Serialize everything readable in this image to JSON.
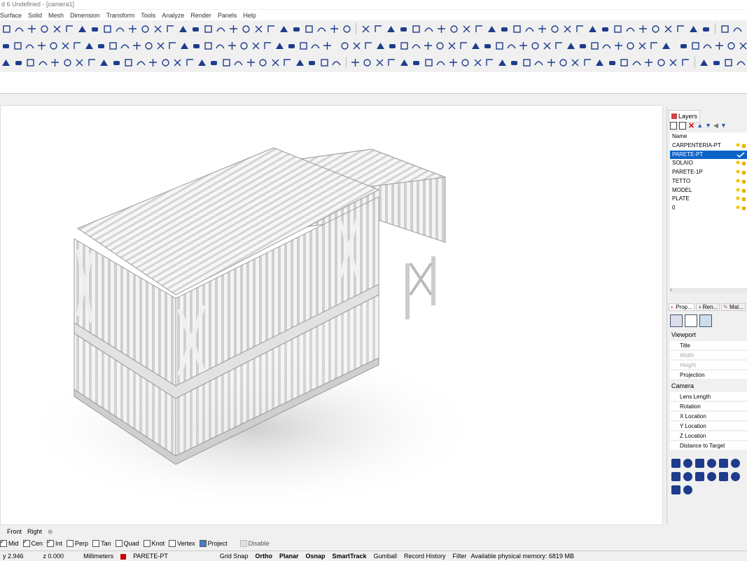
{
  "window": {
    "title": "d 6 Undefined - [camera1]"
  },
  "menu": [
    "Surface",
    "Solid",
    "Mesh",
    "Dimension",
    "Transform",
    "Tools",
    "Analyze",
    "Render",
    "Panels",
    "Help"
  ],
  "layers_panel": {
    "tab_label": "Layers",
    "column_name": "Name",
    "layers": [
      {
        "name": "CARPENTERIA-PT",
        "selected": false
      },
      {
        "name": "PARETE-PT",
        "selected": true
      },
      {
        "name": "SOLAIO",
        "selected": false
      },
      {
        "name": "PARETE-1P",
        "selected": false
      },
      {
        "name": "TETTO",
        "selected": false
      },
      {
        "name": "MODEL",
        "selected": false
      },
      {
        "name": "PLATE",
        "selected": false
      },
      {
        "name": "0",
        "selected": false
      }
    ]
  },
  "properties_panel": {
    "tabs": [
      "Prop...",
      "Ren...",
      "Mat..."
    ],
    "section_viewport": "Viewport",
    "viewport_rows": [
      {
        "label": "Title",
        "disabled": false
      },
      {
        "label": "Width",
        "disabled": true
      },
      {
        "label": "Height",
        "disabled": true
      },
      {
        "label": "Projection",
        "disabled": false
      }
    ],
    "section_camera": "Camera",
    "camera_rows": [
      {
        "label": "Lens Length"
      },
      {
        "label": "Rotation"
      },
      {
        "label": "X Location"
      },
      {
        "label": "Y Location"
      },
      {
        "label": "Z Location"
      },
      {
        "label": "Distance to Target"
      }
    ]
  },
  "viewport_tabs": [
    "Front",
    "Right"
  ],
  "osnap": [
    {
      "label": "Mid",
      "checked": true
    },
    {
      "label": "Cen",
      "checked": true
    },
    {
      "label": "Int",
      "checked": true
    },
    {
      "label": "Perp",
      "checked": false
    },
    {
      "label": "Tan",
      "checked": false
    },
    {
      "label": "Quad",
      "checked": false
    },
    {
      "label": "Knot",
      "checked": false
    },
    {
      "label": "Vertex",
      "checked": false
    }
  ],
  "osnap_project": "Project",
  "osnap_disable": "Disable",
  "status": {
    "y": "y 2.946",
    "z": "z 0.000",
    "units": "Millimeters",
    "layer": "PARETE-PT",
    "grid_snap": "Grid Snap",
    "ortho": "Ortho",
    "planar": "Planar",
    "osnap": "Osnap",
    "smarttrack": "SmartTrack",
    "gumball": "Gumball",
    "record_history": "Record History",
    "filter": "Filter",
    "memory": "Available physical memory: 6819 MB"
  },
  "colors": {
    "selection": "#0a64c8",
    "layer_chip": "#cc0000",
    "toolbar_icon": "#1e3c8c"
  }
}
